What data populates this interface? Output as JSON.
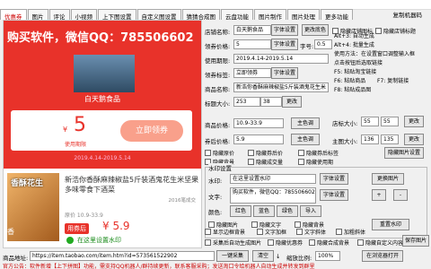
{
  "tabs": [
    "优惠券",
    "图片",
    "评论",
    "小视频",
    "上下图设置",
    "自定义图设置",
    "猜猜合成图",
    "云盘功能",
    "图片制作",
    "图片处理",
    "更多功能"
  ],
  "top_right": "复制机器码",
  "preview": {
    "title": "购买软件，微信QQ：785506602",
    "shop": "白天鹅食品",
    "coupon_value": "5",
    "coupon_yen": "¥",
    "coupon_cond": "使用期限",
    "coupon_btn": "立即领券",
    "coupon_date": "2019.4.14-2019.5.14",
    "product_img_text": "香酥花生",
    "product_badge": "香",
    "product_name": "新浩你香酥麻辣椒盐5斤装酒鬼花生米坚果多味零食下酒菜",
    "sold": "2016笔成交",
    "orig_price": "原价 10.9-33.9",
    "price_tag": "用券后",
    "price": "¥ 5.9",
    "watermark": "在这里设置水印"
  },
  "form": {
    "shop_name_label": "店铺名称:",
    "shop_name": "白天鹅食品",
    "font_btn": "字体设置",
    "change_font_btn": "更改底色",
    "hide_chk1": "隐藏店铺图标",
    "hide_chk2": "隐藏店铺标题",
    "coupon_label": "领券价格:",
    "coupon_value": "5",
    "font_btn2": "字体设置",
    "size_label": "字号:",
    "size_value": "0.5",
    "use_label": "使用期限:",
    "use_value": "2019.4.14-2019.5.14",
    "sign_label": "领券标签:",
    "sign_value": "立即领券",
    "font_btn3": "字体设置",
    "name_label": "商品名称:",
    "name_value": "新浩你香酥麻辣椒盐5斤装酒鬼花生米",
    "title_h_label": "标题大小:",
    "title_h": "253",
    "title_h2": "38",
    "change_btn": "更改",
    "price_label": "商品价格:",
    "price_value": "10.9-33.9",
    "main_color_btn": "主色调",
    "coupon_price_label": "券后价格:",
    "coupon_price": "5.9",
    "main_color_btn2": "主色调",
    "shop_w_label": "店标大小:",
    "shop_w": "55",
    "shop_h": "55",
    "change_btn2": "更改",
    "main_img_label": "主图大小:",
    "main_img_w": "136",
    "main_img_h": "135",
    "change_btn3": "更改",
    "chk_a": "隐藏原价",
    "chk_b": "隐藏券后价",
    "chk_c": "隐藏券后标签",
    "chk_d": "隐藏背景",
    "chk_e": "隐藏成交量",
    "chk_f": "隐藏使用期",
    "hide_all_btn": "隐藏图片设置",
    "wm_header": "水印设置",
    "wm_label": "水印:",
    "wm_value": "在这里设置水印",
    "wm_font_btn": "字体设置",
    "wm_img_btn": "更换图片",
    "text_label": "文字:",
    "text_value": "购买软件，微信QQ：785506602",
    "text_font_btn": "字体设置",
    "plus": "+",
    "minus": "-",
    "color_label": "颜色:",
    "color_btn1": "红色",
    "color_btn2": "蓝色",
    "color_btn3": "绿色",
    "color_btn4": "导入",
    "wm_chk1": "隐藏图片",
    "wm_chk2": "隐藏文字",
    "wm_chk3": "隐藏背景",
    "reset_btn": "重置水印",
    "bot_chk1": "显示边框背景",
    "bot_chk2": "文字加框",
    "bot_chk3": "文字斜体",
    "bot_chk4": "加粗斜体",
    "bot_chk5": "采集后自动生成图片",
    "bot_chk6": "隐藏优惠券",
    "bot_chk7": "隐藏合成背景",
    "bot_chk8": "隐藏自定义内容",
    "save_btn": "保存图片"
  },
  "side": {
    "l1": "Alt+3: 自动生成",
    "l2": "Alt+4: 批量生成",
    "l3": "使用方法：在设置窗口调整输入框",
    "l4": "点击按钮后选取链接",
    "l5": "F5: 粘贴淘宝链接",
    "l6": "F6: 粘贴商品",
    "l7": "F7: 复制链接",
    "l8": "F8: 粘贴成品图"
  },
  "bottom": {
    "url_label": "商品地址:",
    "url_value": "https://item.taobao.com/item.htm?id=573561522902",
    "collect_btn": "一键采集",
    "clear_btn": "清空",
    "sep": "↓",
    "resize_label": "缩放比例:",
    "pct": "100%",
    "open_btn": "在浏览器打开"
  },
  "status": "官方公告：软件新增【上下拼图】功能，需支持QQ机器人/群持续更新，联系客服采购；发送淘口令给机器人自动生成并转发到群里"
}
